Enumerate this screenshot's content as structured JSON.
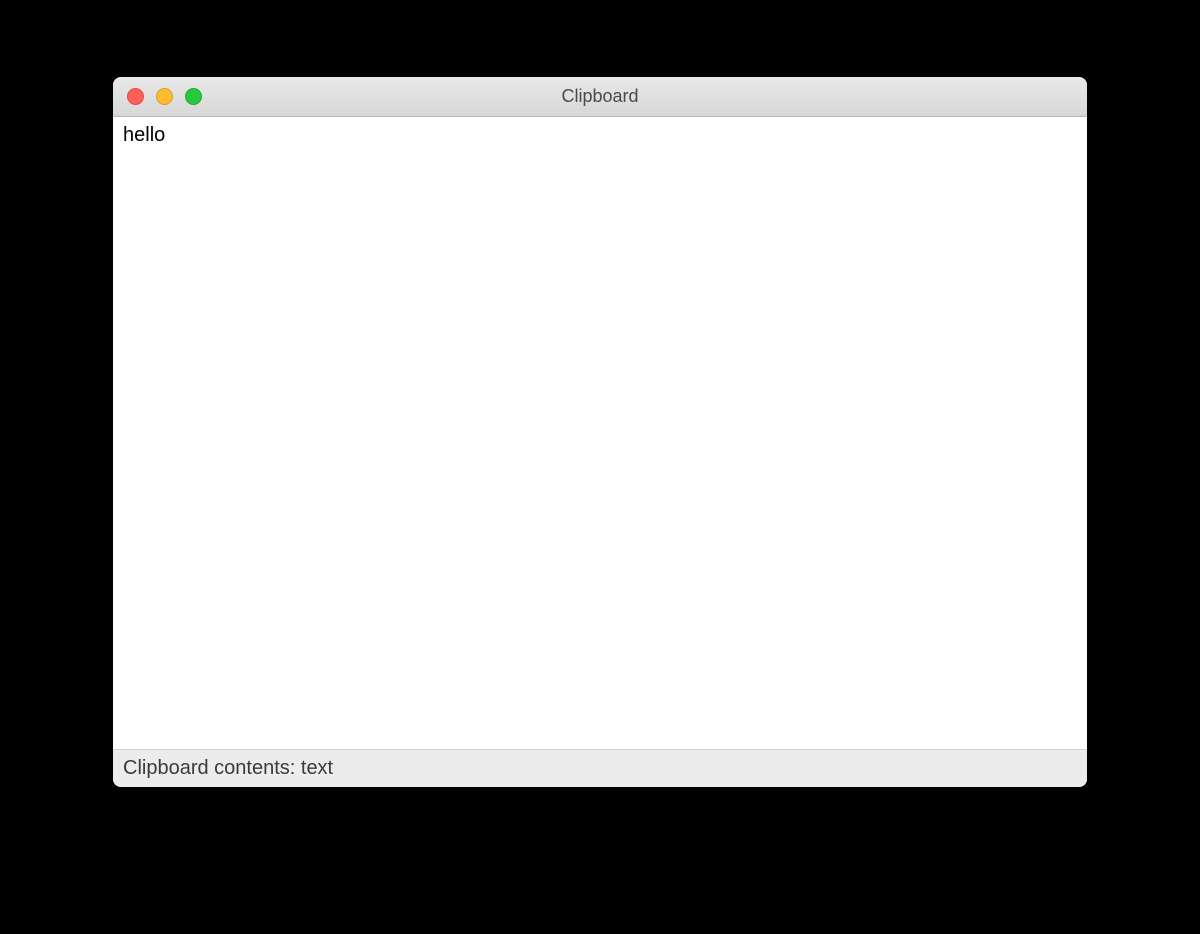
{
  "window": {
    "title": "Clipboard"
  },
  "content": {
    "text": "hello"
  },
  "statusbar": {
    "text": "Clipboard contents: text"
  }
}
